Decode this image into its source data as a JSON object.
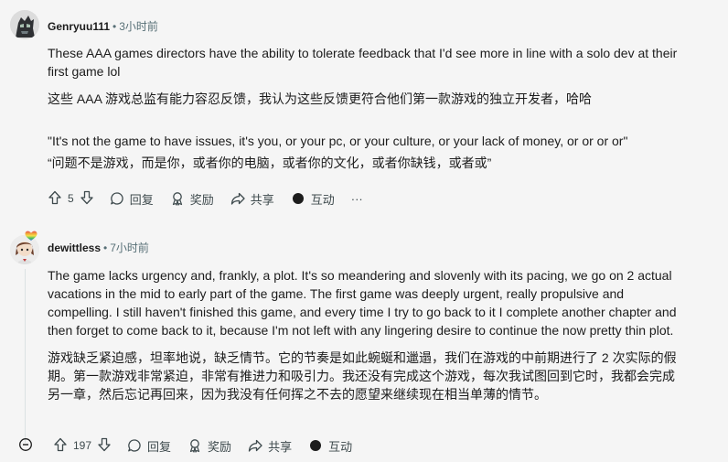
{
  "comments": [
    {
      "author": "Genryuu111",
      "time": "3小时前",
      "paragraphs": [
        "These AAA games directors have the ability to tolerate feedback that I'd see more in line with a solo dev at their first game lol",
        "这些 AAA 游戏总监有能力容忍反馈，我认为这些反馈更符合他们第一款游戏的独立开发者，哈哈",
        "\"It's not the game to have issues, it's you, or your pc, or your culture, or your lack of money, or or or or\"",
        "“问题不是游戏，而是你，或者你的电脑，或者你的文化，或者你缺钱，或者或”"
      ],
      "votes": "5",
      "reply_label": "回复",
      "award_label": "奖励",
      "share_label": "共享",
      "interact_label": "互动",
      "more_label": "···"
    },
    {
      "author": "dewittless",
      "time": "7小时前",
      "paragraphs": [
        "The game lacks urgency and, frankly, a plot. It's so meandering and slovenly with its pacing, we go on 2 actual vacations in the mid to early part of the game. The first game was deeply urgent, really propulsive and compelling. I still haven't finished this game, and every time I try to go back to it I complete another chapter and then forget to come back to it, because I'm not left with any lingering desire to continue the now pretty thin plot.",
        "游戏缺乏紧迫感，坦率地说，缺乏情节。它的节奏是如此蜿蜒和邋遢，我们在游戏的中前期进行了 2 次实际的假期。第一款游戏非常紧迫，非常有推进力和吸引力。我还没有完成这个游戏，每次我试图回到它时，我都会完成另一章，然后忘记再回来，因为我没有任何挥之不去的愿望来继续现在相当单薄的情节。"
      ],
      "votes": "197",
      "reply_label": "回复",
      "award_label": "奖励",
      "share_label": "共享",
      "interact_label": "互动"
    }
  ],
  "icons": {
    "upvote": "arrow-up-icon",
    "downvote": "arrow-down-icon",
    "reply": "speech-bubble-icon",
    "award": "award-icon",
    "share": "share-arrow-icon",
    "interact": "dot-icon",
    "collapse": "minus-circle-icon"
  }
}
